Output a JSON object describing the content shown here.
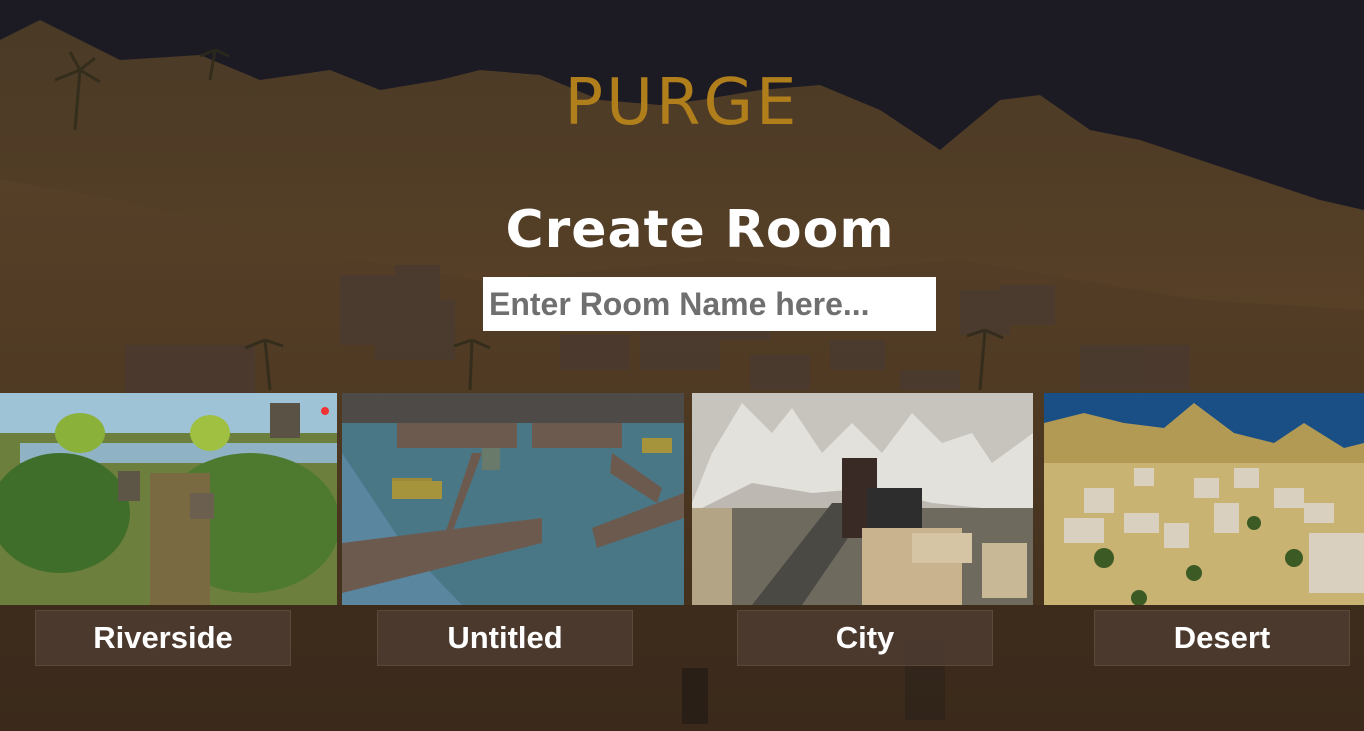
{
  "game": {
    "title": "PURGE"
  },
  "create_room": {
    "heading": "Create Room",
    "room_name_placeholder": "Enter Room Name here..."
  },
  "maps": [
    {
      "name": "Riverside",
      "thumbnail": "riverside-forest-map"
    },
    {
      "name": "Untitled",
      "thumbnail": "stone-arena-map"
    },
    {
      "name": "City",
      "thumbnail": "snowy-city-map"
    },
    {
      "name": "Desert",
      "thumbnail": "desert-village-map"
    }
  ],
  "colors": {
    "title": "#b07f1c",
    "sky": "#1c1b24",
    "sand": "#5b4125",
    "button_bg": "#503e32"
  }
}
